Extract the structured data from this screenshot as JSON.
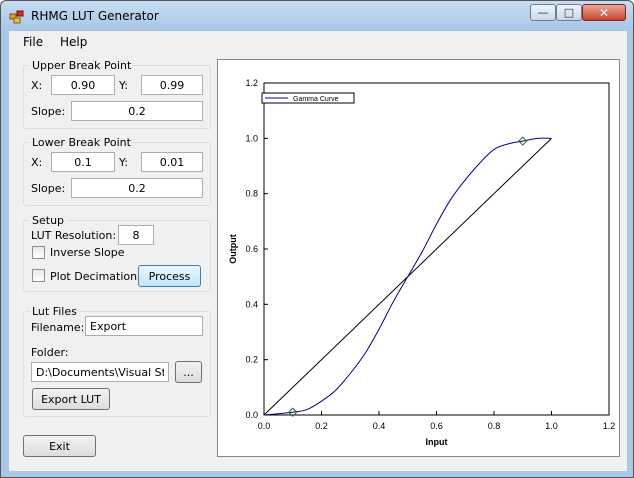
{
  "window": {
    "title": "RHMG LUT Generator",
    "minimize": "—",
    "maximize": "□",
    "close": "✕"
  },
  "menu": {
    "file": "File",
    "help": "Help"
  },
  "upper": {
    "title": "Upper Break Point",
    "x_label": "X:",
    "x_value": "0.90",
    "y_label": "Y:",
    "y_value": "0.99",
    "slope_label": "Slope:",
    "slope_value": "0.2"
  },
  "lower": {
    "title": "Lower Break Point",
    "x_label": "X:",
    "x_value": "0.1",
    "y_label": "Y:",
    "y_value": "0.01",
    "slope_label": "Slope:",
    "slope_value": "0.2"
  },
  "setup": {
    "title": "Setup",
    "res_label": "LUT Resolution:",
    "res_value": "8",
    "inverse_label": "Inverse Slope",
    "inverse_checked": false,
    "decimation_label": "Plot Decimation",
    "decimation_checked": false,
    "process_label": "Process"
  },
  "files": {
    "title": "Lut Files",
    "filename_label": "Filename:",
    "filename_value": "Export",
    "folder_label": "Folder:",
    "folder_value": "D:\\Documents\\Visual Studio",
    "browse_label": "...",
    "export_label": "Export LUT"
  },
  "exit_label": "Exit",
  "colors": {
    "curve": "#00008b",
    "line": "#000000"
  },
  "chart_data": {
    "type": "line",
    "xlabel": "Input",
    "ylabel": "Output",
    "xlim": [
      0,
      1.2
    ],
    "ylim": [
      0,
      1.2
    ],
    "xticks": [
      "0.0",
      "0.2",
      "0.4",
      "0.6",
      "0.8",
      "1.0",
      "1.2"
    ],
    "yticks": [
      "0.0",
      "0.2",
      "0.4",
      "0.6",
      "0.8",
      "1.0",
      "1.2"
    ],
    "legend": "top-left",
    "series": [
      {
        "name": "Gamma Curve",
        "x": [
          0.0,
          0.1,
          0.15,
          0.2,
          0.25,
          0.3,
          0.35,
          0.4,
          0.45,
          0.5,
          0.55,
          0.6,
          0.65,
          0.7,
          0.75,
          0.8,
          0.85,
          0.9,
          0.95,
          1.0
        ],
        "y": [
          0.0,
          0.01,
          0.02,
          0.05,
          0.09,
          0.15,
          0.22,
          0.31,
          0.41,
          0.5,
          0.59,
          0.69,
          0.78,
          0.85,
          0.91,
          0.96,
          0.98,
          0.99,
          1.0,
          1.0
        ]
      },
      {
        "x": [
          0.0,
          1.0
        ],
        "y": [
          0.0,
          1.0
        ]
      }
    ],
    "markers": [
      {
        "x": 0.1,
        "y": 0.01
      },
      {
        "x": 0.9,
        "y": 0.99
      }
    ]
  }
}
